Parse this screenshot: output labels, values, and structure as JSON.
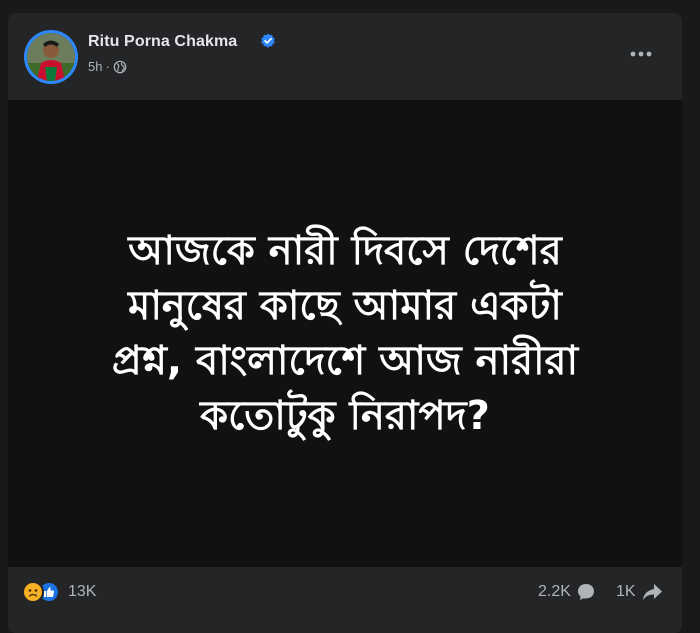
{
  "post": {
    "author": "Ritu Porna Chakma",
    "time": "5h",
    "separator": "·",
    "text_lines": [
      "আজকে নারী দিবসে দেশের",
      "মানুষের কাছে আমার একটা",
      "প্রশ্ন, বাংলাদেশে আজ নারীরা",
      "কতোটুকু নিরাপদ?"
    ]
  },
  "engagement": {
    "reaction_count": "13K",
    "comment_count": "2.2K",
    "share_count": "1K"
  },
  "colors": {
    "card_bg": "#242526",
    "image_bg": "#111114",
    "verified": "#2d88ff",
    "like": "#1b74e4",
    "sad": "#f7b125"
  },
  "icons": {
    "verified": "verified-badge-icon",
    "privacy": "globe-icon",
    "more": "more-options-icon",
    "comment": "comment-icon",
    "share": "share-icon"
  }
}
